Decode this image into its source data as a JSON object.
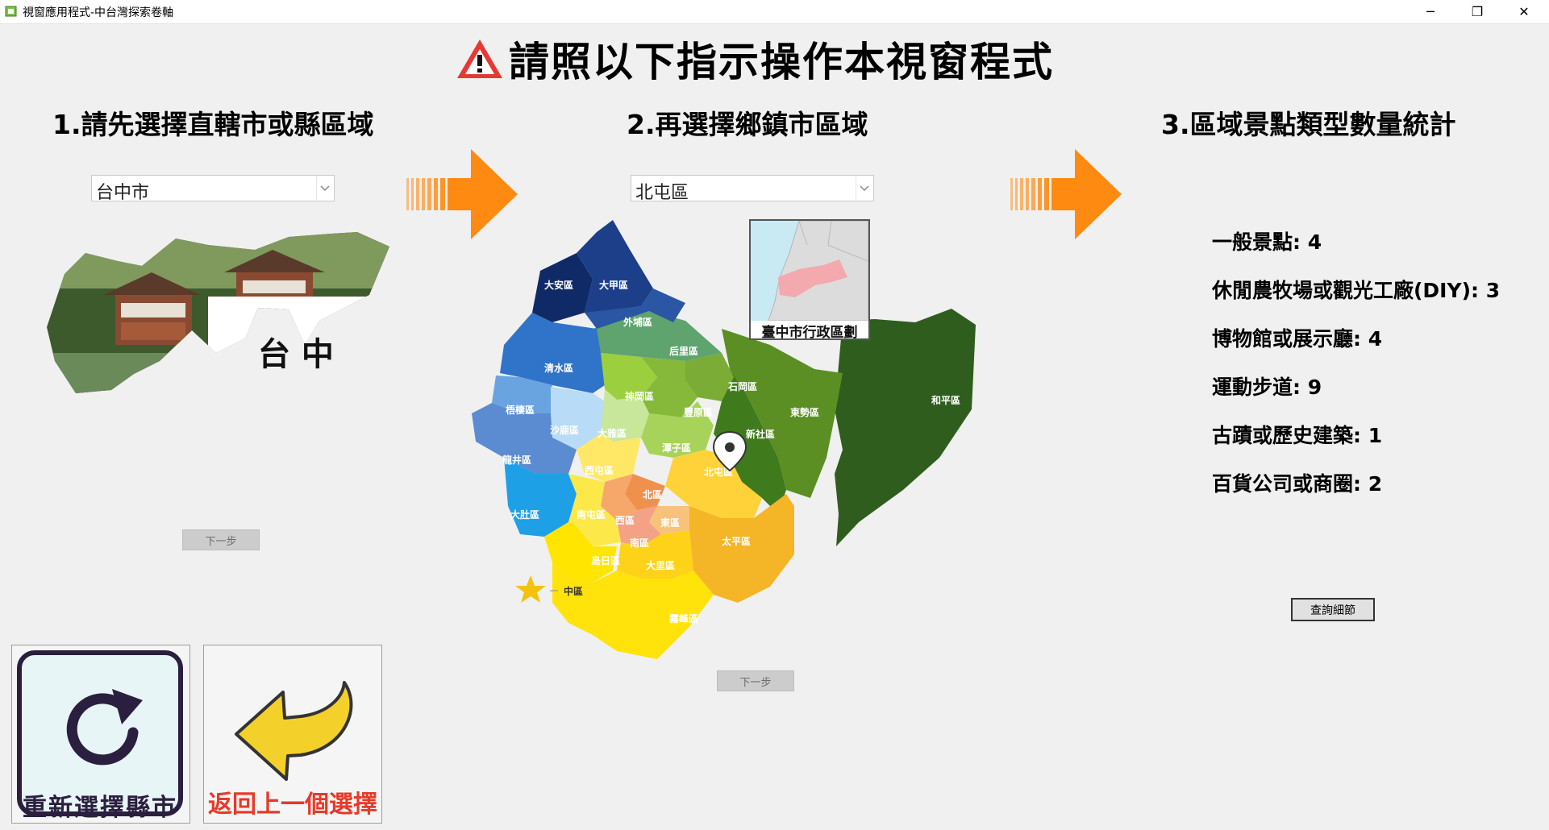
{
  "window": {
    "title": "視窗應用程式-中台灣探索卷軸",
    "minimize": "─",
    "restore": "❐",
    "close": "✕"
  },
  "headline": "請照以下指示操作本視窗程式",
  "steps": {
    "step1": "1.請先選擇直轄市或縣區域",
    "step2": "2.再選擇鄉鎮市區域",
    "step3": "3.區域景點類型數量統計"
  },
  "city_select": {
    "value": "台中市"
  },
  "district_select": {
    "value": "北屯區"
  },
  "city_image": {
    "caption": "台 中"
  },
  "inset_map": {
    "caption": "臺中市行政區劃"
  },
  "map": {
    "districts": [
      "大安區",
      "大甲區",
      "外埔區",
      "清水區",
      "后里區",
      "神岡區",
      "石岡區",
      "東勢區",
      "和平區",
      "梧棲區",
      "沙鹿區",
      "豐原區",
      "新社區",
      "大雅區",
      "潭子區",
      "龍井區",
      "西屯區",
      "北屯區",
      "北區",
      "大肚區",
      "南屯區",
      "西區",
      "東區",
      "南區",
      "太平區",
      "烏日區",
      "大里區",
      "霧峰區"
    ],
    "legend": "中區"
  },
  "stats": [
    "一般景點: 4",
    "休閒農牧場或觀光工廠(DIY): 3",
    "博物館或展示廳: 4",
    "運動步道: 9",
    "古蹟或歷史建築: 1",
    "百貨公司或商圈: 2"
  ],
  "buttons": {
    "next1": "下一步",
    "next2": "下一步",
    "detail": "查詢細節",
    "reset": "重新選擇縣市",
    "back": "返回上一個選擇"
  },
  "colors": {
    "arrow": "#ff8a12",
    "warning": "#e53935",
    "back_text": "#e63a2a"
  }
}
